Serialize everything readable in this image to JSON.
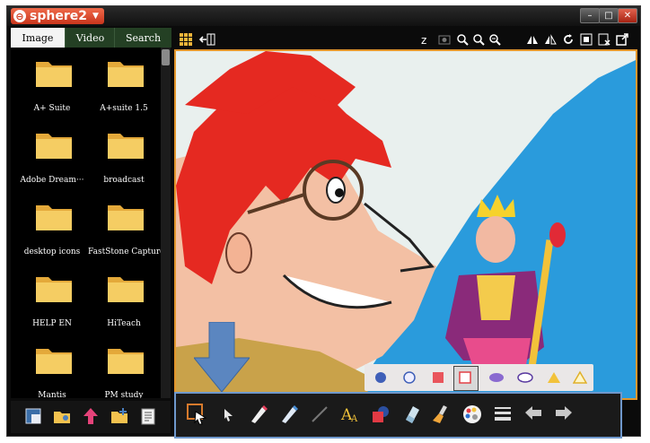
{
  "app": {
    "logo_text": "sphere2"
  },
  "window_controls": {
    "minimize": "–",
    "maximize": "□",
    "close": "✕"
  },
  "tabs": [
    {
      "label": "Image",
      "active": true
    },
    {
      "label": "Video",
      "active": false
    },
    {
      "label": "Search",
      "active": false
    }
  ],
  "files": [
    {
      "label": "A+ Suite"
    },
    {
      "label": "A+suite 1.5"
    },
    {
      "label": "Adobe Dream···"
    },
    {
      "label": "broadcast"
    },
    {
      "label": "desktop icons"
    },
    {
      "label": "FastStone Capture"
    },
    {
      "label": "HELP EN"
    },
    {
      "label": "HiTeach"
    },
    {
      "label": "Mantis"
    },
    {
      "label": "PM study"
    }
  ],
  "colors": {
    "viewer_border": "#e2962c",
    "toolbar_border": "#6f98cc",
    "arrow": "#5b86c0",
    "folder": "#f3c24f"
  },
  "shape_palette": [
    "filled-circle",
    "outline-circle",
    "filled-rect",
    "outline-rect-selected",
    "filled-ellipse",
    "outline-ellipse",
    "filled-triangle",
    "outline-triangle"
  ],
  "drawing_tools": [
    "select-tool",
    "pointer-tool",
    "pen-tool",
    "highlighter-tool",
    "line-tool",
    "text-tool",
    "shape-tool",
    "eraser-tool",
    "clear-tool",
    "color-picker-tool",
    "line-width-tool",
    "undo-tool",
    "redo-tool"
  ]
}
